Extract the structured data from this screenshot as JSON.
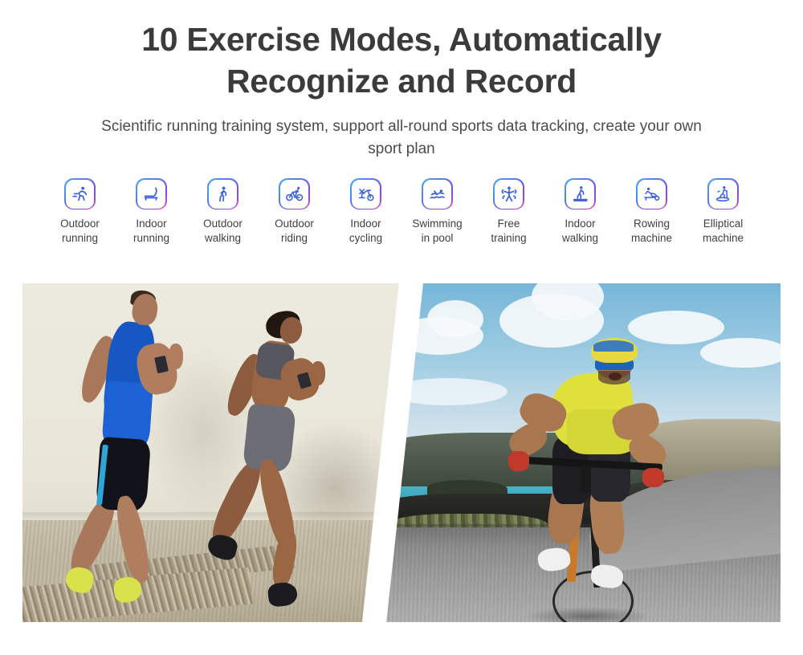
{
  "header": {
    "title": "10 Exercise Modes, Automatically Recognize and Record",
    "subtitle": "Scientific running training system, support all-round sports data tracking, create your own sport plan"
  },
  "theme": {
    "title_color": "#3b3b3b",
    "subtitle_color": "#4c4c4c",
    "icon_gradient_start": "#4aa8f0",
    "icon_gradient_mid": "#4f7ff0",
    "icon_gradient_end": "#d64fc0",
    "icon_glyph_color": "#3a5fe0",
    "background": "#ffffff"
  },
  "exercise_modes": [
    {
      "label": "Outdoor\nrunning",
      "icon": "outdoor-running-icon"
    },
    {
      "label": "Indoor\nrunning",
      "icon": "treadmill-icon"
    },
    {
      "label": "Outdoor\nwalking",
      "icon": "outdoor-walking-icon"
    },
    {
      "label": "Outdoor\nriding",
      "icon": "outdoor-cycling-icon"
    },
    {
      "label": "Indoor\ncycling",
      "icon": "indoor-cycling-icon"
    },
    {
      "label": "Swimming\nin pool",
      "icon": "swimming-icon"
    },
    {
      "label": "Free\ntraining",
      "icon": "free-training-icon"
    },
    {
      "label": "Indoor\nwalking",
      "icon": "indoor-walking-icon"
    },
    {
      "label": "Rowing\nmachine",
      "icon": "rowing-machine-icon"
    },
    {
      "label": "Elliptical\nmachine",
      "icon": "elliptical-machine-icon"
    }
  ],
  "photos": {
    "left": {
      "name": "outdoor-runners-photo",
      "description": "A man in a blue tank top and a woman in grey sportswear running outdoors beside a sunlit wall, both wearing fitness trackers"
    },
    "right": {
      "name": "road-cyclist-photo",
      "description": "A cyclist in a yellow jersey and striped helmet riding hard on a coastal road with sea and rocky cliffs behind"
    }
  }
}
